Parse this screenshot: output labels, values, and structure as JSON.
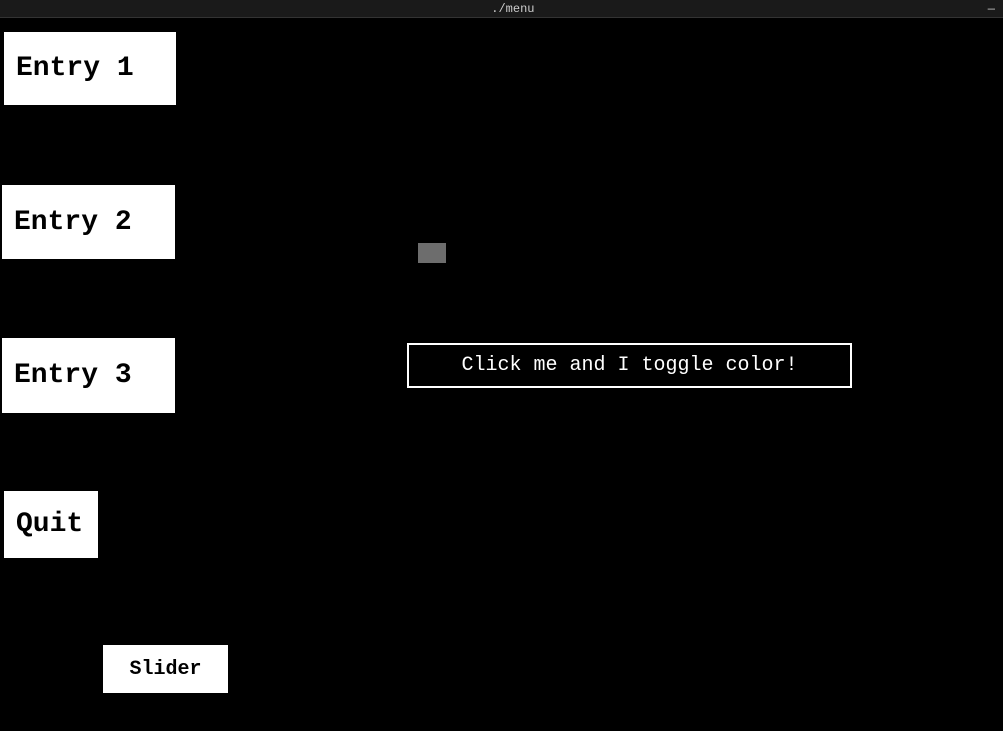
{
  "titlebar": {
    "title": "./menu",
    "close_label": "—"
  },
  "menu": {
    "entry1_label": "Entry 1",
    "entry2_label": "Entry 2",
    "entry3_label": "Entry 3",
    "quit_label": "Quit",
    "slider_label": "Slider",
    "toggle_label": "Click me and I toggle color!"
  }
}
